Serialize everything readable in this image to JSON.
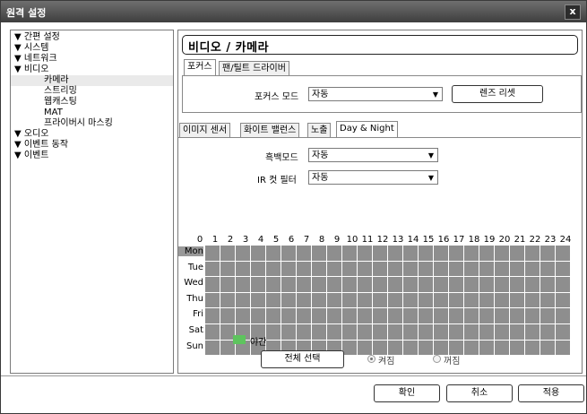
{
  "window": {
    "title": "원격 설정",
    "close_label": "x"
  },
  "tree": {
    "items": [
      {
        "label": "▼ 간편 설정"
      },
      {
        "label": "▼ 시스템"
      },
      {
        "label": "▼ 네트워크"
      },
      {
        "label": "▼ 비디오"
      },
      {
        "label": "카메라"
      },
      {
        "label": "스트리밍"
      },
      {
        "label": "웹캐스팅"
      },
      {
        "label": "MAT"
      },
      {
        "label": "프라이버시 마스킹"
      },
      {
        "label": "▼ 오디오"
      },
      {
        "label": "▼ 이벤트 동작"
      },
      {
        "label": "▼ 이벤트"
      }
    ]
  },
  "header": {
    "title": "비디오 / 카메라"
  },
  "top_tabs": [
    "포커스",
    "팬/틸트 드라이버"
  ],
  "focus": {
    "mode_label": "포커스 모드",
    "mode_value": "자동",
    "reset_label": "렌즈 리셋"
  },
  "sub_tabs": [
    "이미지 센서",
    "화이트 밸런스",
    "노출",
    "Day & Night"
  ],
  "daynight": {
    "bw_label": "흑백모드",
    "bw_value": "자동",
    "ir_label": "IR 컷 필터",
    "ir_value": "자동",
    "hours": [
      "0",
      "1",
      "2",
      "3",
      "4",
      "5",
      "6",
      "7",
      "8",
      "9",
      "10",
      "11",
      "12",
      "13",
      "14",
      "15",
      "16",
      "17",
      "18",
      "19",
      "20",
      "21",
      "22",
      "23",
      "24"
    ],
    "days": [
      "Mon",
      "Tue",
      "Wed",
      "Thu",
      "Fri",
      "Sat",
      "Sun"
    ],
    "legend_label": "야간",
    "legend_color": "#5ec45e",
    "cell_color": "#8e8e8e",
    "select_all_label": "전체 선택",
    "on_label": "켜짐",
    "off_label": "꺼짐",
    "selected_radio": "on"
  },
  "footer": {
    "ok_label": "확인",
    "cancel_label": "취소",
    "apply_label": "적용"
  }
}
